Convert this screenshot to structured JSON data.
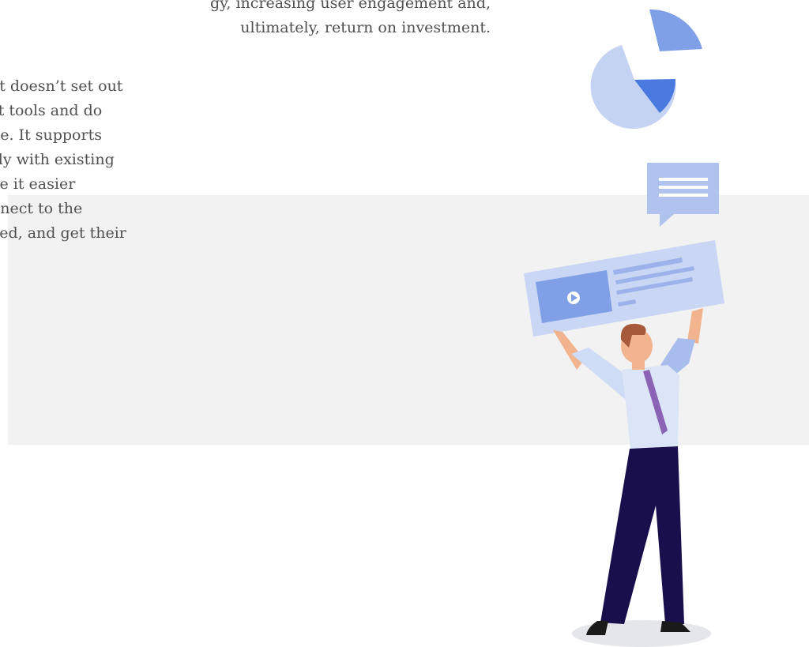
{
  "top_paragraph": {
    "lines": [
      "gy, increasing user engagement and,",
      "ultimately, return on investment."
    ]
  },
  "left_paragraph": {
    "lines": [
      "et doesn’t set out",
      "st tools and do",
      "ne. It supports",
      "sly with existing",
      "ke it easier",
      "nnect to the",
      "eed, and get their"
    ]
  },
  "colors": {
    "band": "#f2f2f2",
    "accent_blue": "#4a7ae0",
    "light_blue": "#c5d3f3",
    "mid_blue": "#7f9fe6",
    "suit_navy": "#1a0f4d",
    "tie_purple": "#8a63b5"
  },
  "illustration": {
    "icons": [
      "pie-chart-icon",
      "chat-bubble-icon",
      "video-card-icon",
      "person-figure"
    ]
  }
}
